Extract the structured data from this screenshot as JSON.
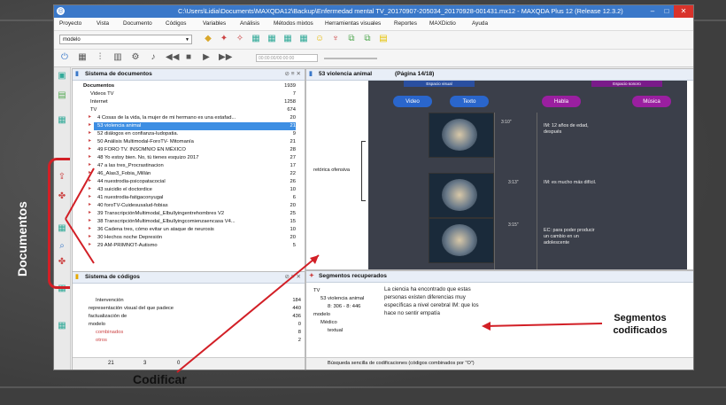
{
  "window": {
    "title": "C:\\Users\\Lidia\\Documents\\MAXQDA12\\Backup\\Enfermedad mental TV_20170907-205034_20170928-001431.mx12 - MAXQDA Plus 12 (Release 12.3.2)",
    "minimize": "–",
    "maximize": "□",
    "close": "✕"
  },
  "menu": [
    "Proyecto",
    "Vista",
    "Documento",
    "Códigos",
    "Variables",
    "Análisis",
    "Métodos mixtos",
    "Herramientas visuales",
    "Reportes",
    "MAXDictio",
    "Ayuda"
  ],
  "toolbar": {
    "mode_value": "modelo",
    "timecode": "00:00:00/00:00:00"
  },
  "document_system": {
    "title": "Sistema de documentos",
    "header_right": "⊘ ≡ ✕",
    "items": [
      {
        "label": "Documentos",
        "count": "1939",
        "level": 0,
        "kind": "root"
      },
      {
        "label": "Videos TV",
        "count": "7",
        "level": 1,
        "kind": "folder"
      },
      {
        "label": "Internet",
        "count": "1258",
        "level": 1,
        "kind": "folder"
      },
      {
        "label": "TV",
        "count": "674",
        "level": 1,
        "kind": "folder"
      },
      {
        "label": "4 Cosas de la vida, la mujer de mi hermano es una estafad...",
        "count": "20",
        "level": 2,
        "kind": "doc"
      },
      {
        "label": "53 violencia animal",
        "count": "21",
        "level": 2,
        "kind": "doc",
        "selected": true
      },
      {
        "label": "52 diálogos en confianza-ludopatia.",
        "count": "9",
        "level": 2,
        "kind": "doc"
      },
      {
        "label": "50 Análisis Multimodal-ForoTV- Mitomanía",
        "count": "21",
        "level": 2,
        "kind": "doc"
      },
      {
        "label": "49 FORO TV. INSOMNIO EN MÉXICO",
        "count": "28",
        "level": 2,
        "kind": "doc"
      },
      {
        "label": "48 Yo estoy bien. No, tú tienes esquizo 2017",
        "count": "27",
        "level": 2,
        "kind": "doc"
      },
      {
        "label": "47 a las tres_Procrastinacion",
        "count": "17",
        "level": 2,
        "kind": "doc"
      },
      {
        "label": "46_Alas3_Fobia_Millán",
        "count": "22",
        "level": 2,
        "kind": "doc"
      },
      {
        "label": "44 nuestrodia-psicopatacocial",
        "count": "26",
        "level": 2,
        "kind": "doc"
      },
      {
        "label": "43 suicidio el doctordice",
        "count": "10",
        "level": 2,
        "kind": "doc"
      },
      {
        "label": "41 nuestrodia-fatigaconyugal",
        "count": "6",
        "level": 2,
        "kind": "doc"
      },
      {
        "label": "40 foroTV-Cuidesusalud-fobias",
        "count": "20",
        "level": 2,
        "kind": "doc"
      },
      {
        "label": "39 TranscripciónMultimodal_Elbullyingentrehombres V2",
        "count": "25",
        "level": 2,
        "kind": "doc"
      },
      {
        "label": "38 TranscripciónMultimodal_Elbullyingcomienzaencasa V4...",
        "count": "15",
        "level": 2,
        "kind": "doc"
      },
      {
        "label": "36 Cadena tres, cómo evitar un ataque de neurosis",
        "count": "10",
        "level": 2,
        "kind": "doc"
      },
      {
        "label": "30 Hechos noche Depresión",
        "count": "20",
        "level": 2,
        "kind": "doc"
      },
      {
        "label": "29 AM-PRIMNOT-Autismo",
        "count": "5",
        "level": 2,
        "kind": "doc"
      }
    ]
  },
  "code_system": {
    "title": "Sistema de códigos",
    "header_right": "⊘ ≡ ✕",
    "items": [
      {
        "label": "Intervención",
        "count": "184",
        "level": 1
      },
      {
        "label": "representación visual del que padece",
        "count": "440",
        "level": 0
      },
      {
        "label": "factualización de",
        "count": "436",
        "level": 0
      },
      {
        "label": "modelo",
        "count": "0",
        "level": 0
      },
      {
        "label": "combinados",
        "count": "8",
        "level": 1
      },
      {
        "label": "otros",
        "count": "2",
        "level": 1
      }
    ],
    "status": [
      "21",
      "3",
      "0"
    ]
  },
  "document_browser": {
    "title": "53 violencia animal",
    "page": "(Página 14/18)",
    "code_label": "retórica ofensiva",
    "header_tabs": [
      "Espacio visual",
      "Espacio sonoro"
    ],
    "buttons": [
      "Video",
      "Texto",
      "Habla",
      "Música"
    ],
    "rows": [
      {
        "time": "3:10\"",
        "text": "IM: 12 años de edad, después"
      },
      {
        "time": "3:13\"",
        "text": "IM: es mucho más difícil."
      },
      {
        "time": "3:15\"",
        "text": "EC: para poder producir un cambio en un adolescente"
      }
    ]
  },
  "retrieved_segments": {
    "title": "Segmentos recuperados",
    "tree": [
      {
        "label": "TV",
        "level": 0
      },
      {
        "label": "53 violencia animal",
        "level": 1
      },
      {
        "label": "8: 306 - 8: 446",
        "level": 2
      },
      {
        "label": "modelo",
        "level": 0
      },
      {
        "label": "Médico",
        "level": 1
      },
      {
        "label": "textual",
        "level": 2
      }
    ],
    "segment_text": "La ciencia ha encontrado que estas personas existen diferencias muy específicas a nivel cerebral IM: que los hace no sentir empatía",
    "status": "Búsqueda sencilla de codificaciones (códigos combinados por \"O\")"
  },
  "annotations": {
    "documentos": "Documentos",
    "codificar": "Codificar",
    "segmentos": "Segmentos codificados"
  },
  "colors": {
    "accent": "#3a78c9",
    "annotation_red": "#d21f26",
    "selection": "#3d8ee3"
  }
}
